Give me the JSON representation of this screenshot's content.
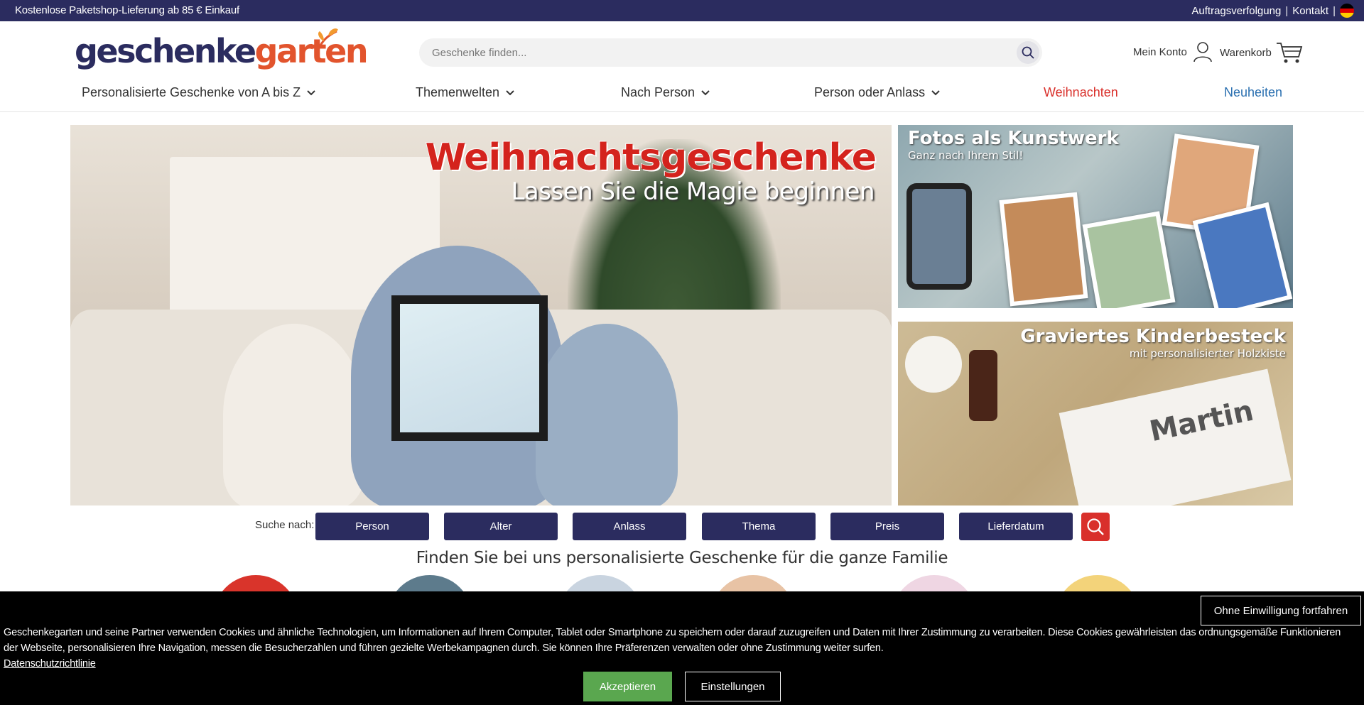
{
  "topbar": {
    "promo": "Kostenlose Paketshop-Lieferung ab 85 € Einkauf",
    "tracking": "Auftragsverfolgung",
    "contact": "Kontakt",
    "separator": "|"
  },
  "header": {
    "logo_part1": "geschenke",
    "logo_part2": "garten",
    "search_placeholder": "Geschenke finden...",
    "account_label": "Mein Konto",
    "cart_label": "Warenkorb"
  },
  "nav": {
    "items": [
      {
        "label": "Personalisierte Geschenke von A bis Z"
      },
      {
        "label": "Themenwelten"
      },
      {
        "label": "Nach Person"
      },
      {
        "label": "Person oder Anlass"
      },
      {
        "label": "Weihnachten"
      },
      {
        "label": "Neuheiten"
      }
    ]
  },
  "hero": {
    "title": "Weihnachtsgeschenke",
    "subtitle": "Lassen Sie die Magie beginnen"
  },
  "side_banners": [
    {
      "title": "Fotos als Kunstwerk",
      "subtitle": "Ganz nach Ihrem Stil!"
    },
    {
      "title": "Graviertes Kinderbesteck",
      "subtitle": "mit personalisierter Holzkiste",
      "name_on_box": "Martin"
    }
  ],
  "filter": {
    "label": "Suche nach:",
    "buttons": [
      "Person",
      "Alter",
      "Anlass",
      "Thema",
      "Preis",
      "Lieferdatum"
    ]
  },
  "section_heading": "Finden Sie bei uns personalisierte Geschenke für die ganze Familie",
  "cookie": {
    "continue_label": "Ohne Einwilligung fortfahren",
    "text": "Geschenkegarten und seine Partner verwenden Cookies und ähnliche Technologien, um Informationen auf Ihrem Computer, Tablet oder Smartphone zu speichern oder darauf zuzugreifen und Daten mit Ihrer Zustimmung zu verarbeiten. Diese Cookies gewährleisten das ordnungsgemäße Funktionieren der Webseite, personalisieren Ihre Navigation, messen die Besucherzahlen und führen gezielte Werbekampagnen durch. Sie können Ihre Präferenzen verwalten oder ohne Zustimmung weiter surfen.",
    "privacy_link": "Datenschutzrichtlinie",
    "accept_label": "Akzeptieren",
    "settings_label": "Einstellungen"
  },
  "colors": {
    "brand_navy": "#2b2c5f",
    "brand_orange": "#e2542d",
    "christmas_red": "#d9302b",
    "new_blue": "#2a6fb0",
    "accept_green": "#5aa74f"
  }
}
